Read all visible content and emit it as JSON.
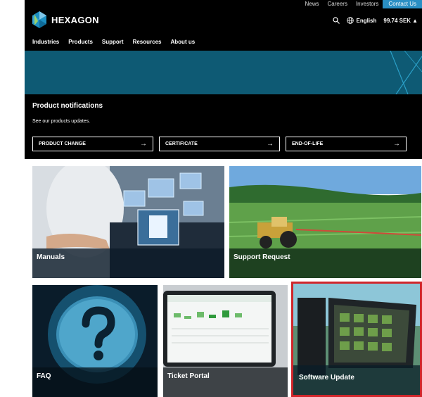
{
  "topbar": {
    "items": [
      "News",
      "Careers",
      "Investors"
    ],
    "contact": "Contact Us"
  },
  "brand": {
    "name": "HEXAGON"
  },
  "nav": [
    "Industries",
    "Products",
    "Support",
    "Resources",
    "About us"
  ],
  "header": {
    "language": "English",
    "cart": "99.74 SEK"
  },
  "notifications": {
    "title": "Product notifications",
    "subtitle": "See our products updates.",
    "buttons": [
      "PRODUCT CHANGE",
      "CERTIFICATE",
      "END-OF-LIFE"
    ]
  },
  "cards": {
    "manuals": "Manuals",
    "support": "Support Request",
    "faq": "FAQ",
    "ticket": "Ticket Portal",
    "software": "Software Update"
  },
  "colors": {
    "hero": "#0e5a74",
    "highlight": "#d0262b",
    "contact": "#2a8fc4"
  }
}
